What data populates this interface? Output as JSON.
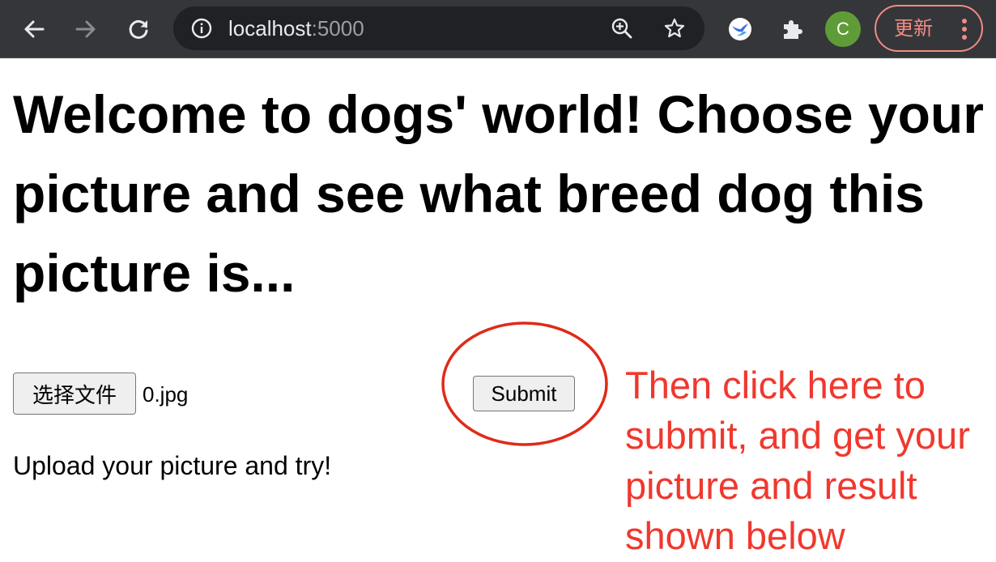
{
  "browser": {
    "url_host": "localhost",
    "url_port": ":5000",
    "profile_initial": "C",
    "update_label": "更新",
    "icons": {
      "back": "back-arrow-icon",
      "forward": "forward-arrow-icon",
      "reload": "reload-icon",
      "site_info": "info-icon",
      "zoom": "zoom-in-icon",
      "bookmark": "star-icon",
      "extension_bird": "bird-extension-icon",
      "extensions": "puzzle-icon",
      "menu": "more-vert-icon"
    },
    "colors": {
      "toolbar": "#35363a",
      "omnibox": "#202124",
      "avatar": "#5f9c38",
      "update_accent": "#f28b82"
    }
  },
  "page": {
    "heading": "Welcome to dogs' world! Choose your picture and see what breed dog this picture is...",
    "file_button_label": "选择文件",
    "file_name": "0.jpg",
    "submit_label": "Submit",
    "hint": "Upload your picture and try!"
  },
  "annotation": {
    "lines": [
      "Then click here to",
      "submit, and get your",
      "picture and result",
      "shown below"
    ],
    "color": "#f0382e"
  }
}
